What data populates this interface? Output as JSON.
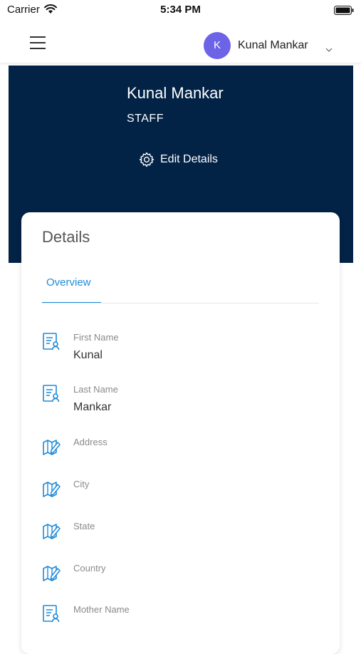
{
  "status_bar": {
    "carrier": "Carrier",
    "time": "5:34 PM"
  },
  "nav": {
    "avatar_initial": "K",
    "user_name": "Kunal Mankar"
  },
  "header": {
    "name": "Kunal Mankar",
    "role": "STAFF",
    "edit_label": "Edit Details"
  },
  "card": {
    "title": "Details",
    "tab_label": "Overview",
    "fields": [
      {
        "label": "First Name",
        "value": "Kunal",
        "icon": "contact-card-icon"
      },
      {
        "label": "Last Name",
        "value": "Mankar",
        "icon": "contact-card-icon"
      },
      {
        "label": "Address",
        "value": "",
        "icon": "map-edit-icon"
      },
      {
        "label": "City",
        "value": "",
        "icon": "map-edit-icon"
      },
      {
        "label": "State",
        "value": "",
        "icon": "map-edit-icon"
      },
      {
        "label": "Country",
        "value": "",
        "icon": "map-edit-icon"
      },
      {
        "label": "Mother Name",
        "value": "",
        "icon": "contact-card-icon"
      }
    ]
  },
  "colors": {
    "header_bg": "#022246",
    "accent": "#1f8ad8",
    "avatar_bg": "#6c63e6"
  }
}
